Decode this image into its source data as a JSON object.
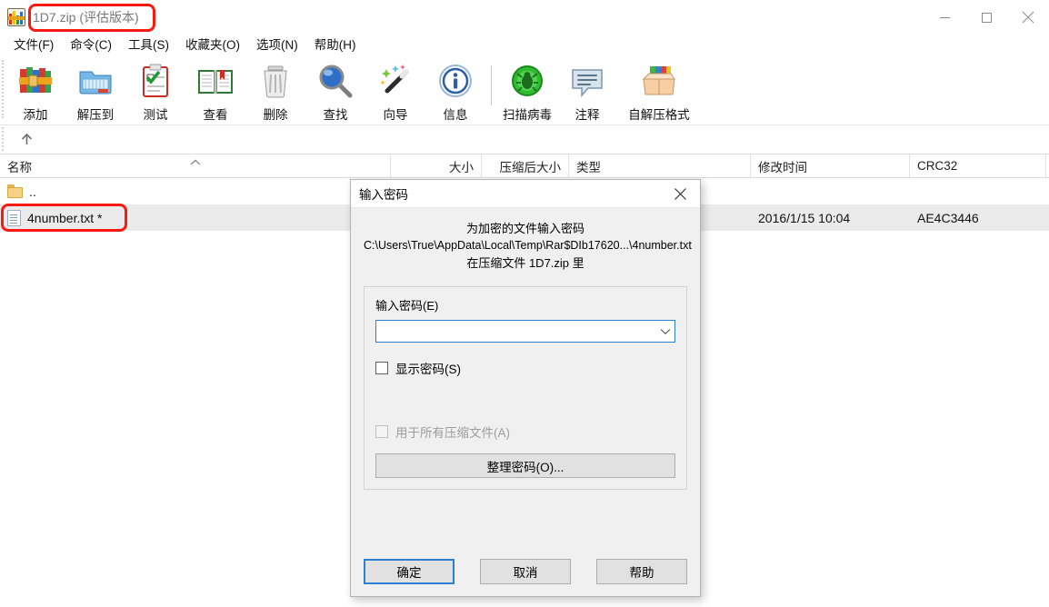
{
  "window": {
    "title": "1D7.zip (评估版本)",
    "app_icon": "winrar-books-icon",
    "controls": {
      "minimize": "minimize-icon",
      "maximize": "maximize-icon",
      "close": "close-icon"
    }
  },
  "menu": {
    "items": [
      {
        "label": "文件(F)",
        "name": "menu-file"
      },
      {
        "label": "命令(C)",
        "name": "menu-commands"
      },
      {
        "label": "工具(S)",
        "name": "menu-tools"
      },
      {
        "label": "收藏夹(O)",
        "name": "menu-favorites"
      },
      {
        "label": "选项(N)",
        "name": "menu-options"
      },
      {
        "label": "帮助(H)",
        "name": "menu-help"
      }
    ]
  },
  "toolbar": {
    "buttons": [
      {
        "label": "添加",
        "icon": "add-archive-icon"
      },
      {
        "label": "解压到",
        "icon": "extract-to-icon"
      },
      {
        "label": "测试",
        "icon": "test-icon"
      },
      {
        "label": "查看",
        "icon": "view-icon"
      },
      {
        "label": "删除",
        "icon": "delete-icon"
      },
      {
        "label": "查找",
        "icon": "find-icon"
      },
      {
        "label": "向导",
        "icon": "wizard-icon"
      },
      {
        "label": "信息",
        "icon": "info-icon"
      },
      {
        "label": "扫描病毒",
        "icon": "virus-scan-icon"
      },
      {
        "label": "注释",
        "icon": "comment-icon"
      },
      {
        "label": "自解压格式",
        "icon": "sfx-icon"
      }
    ]
  },
  "nav": {
    "up_icon": "up-arrow-icon"
  },
  "file_list": {
    "columns": [
      {
        "label": "名称",
        "sorted": "asc"
      },
      {
        "label": "大小"
      },
      {
        "label": "压缩后大小"
      },
      {
        "label": "类型"
      },
      {
        "label": "修改时间"
      },
      {
        "label": "CRC32"
      }
    ],
    "rows": [
      {
        "name": "..",
        "icon": "folder-icon",
        "size": "",
        "packed": "",
        "type": "",
        "modified": "",
        "crc32": "",
        "selected": false
      },
      {
        "name": "4number.txt *",
        "icon": "text-file-icon",
        "size": "",
        "packed": "",
        "type": "",
        "modified": "2016/1/15 10:04",
        "crc32": "AE4C3446",
        "selected": true
      }
    ]
  },
  "dialog": {
    "title": "输入密码",
    "close_icon": "close-icon",
    "message_line1": "为加密的文件输入密码",
    "message_line2": "C:\\Users\\True\\AppData\\Local\\Temp\\Rar$DIb17620...\\4number.txt",
    "message_line3": "在压缩文件 1D7.zip 里",
    "password_label": "输入密码(E)",
    "password_value": "",
    "password_placeholder": "",
    "dropdown_icon": "chevron-down-icon",
    "show_password_label": "显示密码(S)",
    "show_password_checked": false,
    "use_for_all_label": "用于所有压缩文件(A)",
    "use_for_all_checked": false,
    "use_for_all_disabled": true,
    "organize_label": "整理密码(O)...",
    "ok_label": "确定",
    "cancel_label": "取消",
    "help_label": "帮助"
  },
  "annotations": {
    "title_highlight": "红框标注-标题",
    "file_highlight": "红框标注-文件"
  },
  "colors": {
    "annotation_red": "#fb1a12",
    "focus_blue": "#2a7fd4",
    "selected_row": "#ebebeb",
    "dialog_bg": "#f0f0f0"
  }
}
